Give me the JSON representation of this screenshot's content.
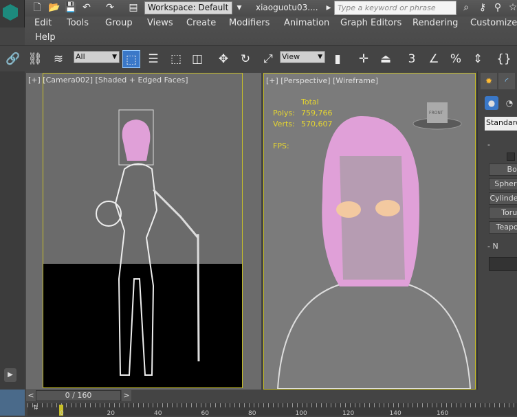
{
  "titlebar": {
    "workspace": "Workspace: Default",
    "filename": "xiaoguotu03....",
    "search_placeholder": "Type a keyword or phrase"
  },
  "menu": [
    "Edit",
    "Tools",
    "Group",
    "Views",
    "Create",
    "Modifiers",
    "Animation",
    "Graph Editors",
    "Rendering",
    "Customize",
    "Help"
  ],
  "toolbar": {
    "selection_filter": "All",
    "reference_coord": "View",
    "snap_angle_label": "3",
    "percent_label": "%"
  },
  "viewports": {
    "left": {
      "label": "[+] [Camera002] [Shaded + Edged Faces]"
    },
    "right": {
      "label": "[+] [Perspective] [Wireframe]",
      "stats": {
        "header": "Total",
        "polys_label": "Polys:",
        "polys": "759,766",
        "verts_label": "Verts:",
        "verts": "570,607",
        "fps_label": "FPS:"
      },
      "viewcube": "FRONT"
    }
  },
  "command_panel": {
    "category": "Standard",
    "buttons": [
      "Box",
      "Sphere",
      "Cylinder",
      "Torus",
      "Teapot"
    ],
    "rollout1": "-",
    "rollout2": "- N"
  },
  "timeline": {
    "frame": "0 / 160",
    "prev": "<",
    "next": ">",
    "ticks": [
      "0",
      "20",
      "40",
      "60",
      "80",
      "100",
      "120",
      "140",
      "160"
    ]
  },
  "colors": {
    "viewport_border": "#c8c028",
    "stats_text": "#e6d630",
    "hair": "#e0a0d8",
    "active_tool": "#3a78c8"
  }
}
